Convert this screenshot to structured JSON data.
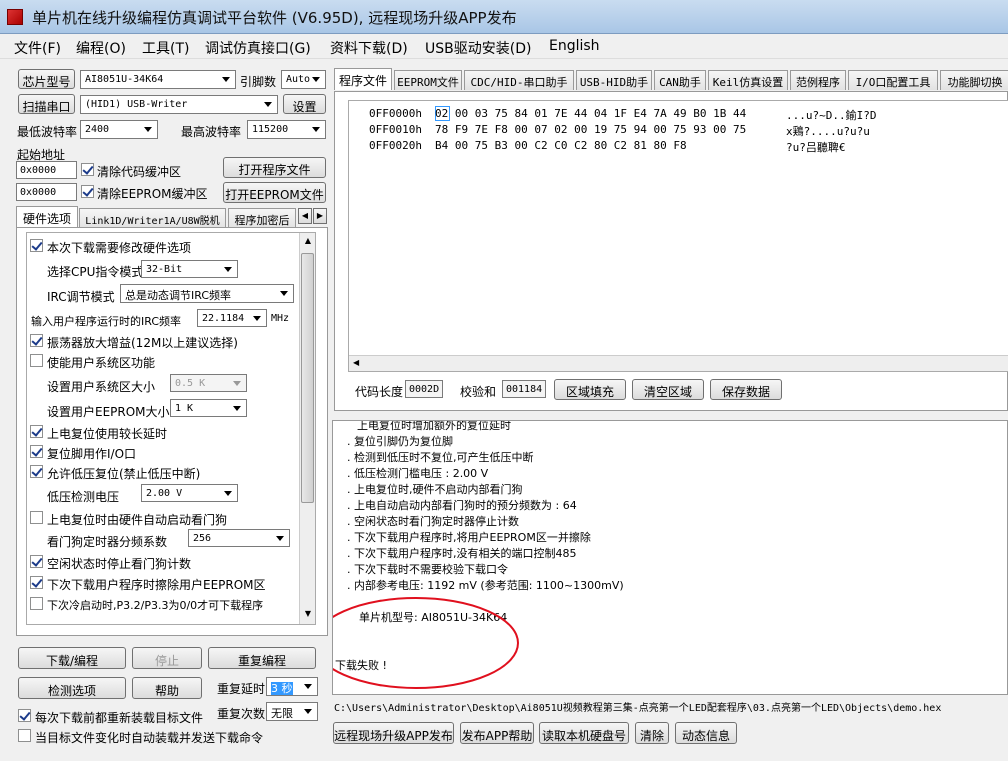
{
  "window": {
    "title": "单片机在线升级编程仿真调试平台软件 (V6.95D), 远程现场升级APP发布"
  },
  "menu": [
    "文件(F)",
    "编程(O)",
    "工具(T)",
    "调试仿真接口(G)",
    "资料下载(D)",
    "USB驱动安装(D)",
    "English"
  ],
  "left": {
    "chip_btn": "芯片型号",
    "chip_value": "AI8051U-34K64",
    "pins_label": "引脚数",
    "pins_value": "Auto",
    "scan_btn": "扫描串口",
    "port_value": "(HID1) USB-Writer",
    "settings_btn": "设置",
    "min_baud_label": "最低波特率",
    "min_baud_value": "2400",
    "max_baud_label": "最高波特率",
    "max_baud_value": "115200",
    "start_addr_label": "起始地址",
    "code_addr": "0x0000",
    "clear_code_label": "清除代码缓冲区",
    "open_prog_btn": "打开程序文件",
    "eeprom_addr": "0x0000",
    "clear_eeprom_label": "清除EEPROM缓冲区",
    "open_eeprom_btn": "打开EEPROM文件",
    "tabs": [
      "硬件选项",
      "Link1D/Writer1A/U8W脱机",
      "程序加密后"
    ],
    "hw": {
      "modify_hw": "本次下载需要修改硬件选项",
      "cpu_label": "选择CPU指令模式",
      "cpu_value": "32-Bit",
      "irc_label": "IRC调节模式",
      "irc_value": "总是动态调节IRC频率",
      "freq_label": "输入用户程序运行时的IRC频率",
      "freq_value": "22.1184",
      "freq_unit": "MHz",
      "osc": "振荡器放大增益(12M以上建议选择)",
      "sys_area": "使能用户系统区功能",
      "sys_size_label": "设置用户系统区大小",
      "sys_size_value": "0.5 K",
      "eeprom_size_label": "设置用户EEPROM大小",
      "eeprom_size_value": "1   K",
      "long_delay": "上电复位使用较长延时",
      "reset_io": "复位脚用作I/O口",
      "lvr": "允许低压复位(禁止低压中断)",
      "lvd_label": "低压检测电压",
      "lvd_value": "2.00 V",
      "wdt_auto": "上电复位时由硬件自动启动看门狗",
      "wdt_div_label": "看门狗定时器分频系数",
      "wdt_div_value": "256",
      "idle_wdt": "空闲状态时停止看门狗计数",
      "erase_eeprom": "下次下载用户程序时擦除用户EEPROM区",
      "p32p33": "下次冷启动时,P3.2/P3.3为0/0才可下载程序"
    },
    "download_btn": "下载/编程",
    "stop_btn": "停止",
    "reprog_btn": "重复编程",
    "detect_btn": "检测选项",
    "help_btn": "帮助",
    "repeat_delay_label": "重复延时",
    "repeat_delay_value": "3 秒",
    "repeat_count_label": "重复次数",
    "repeat_count_value": "无限",
    "reload_label": "每次下载前都重新装载目标文件",
    "autoload_label": "当目标文件变化时自动装载并发送下载命令"
  },
  "right": {
    "tabs": [
      "程序文件",
      "EEPROM文件",
      "CDC/HID-串口助手",
      "USB-HID助手",
      "CAN助手",
      "Keil仿真设置",
      "范例程序",
      "I/O口配置工具",
      "功能脚切换"
    ],
    "hex_rows": [
      {
        "addr": "0FF0000h",
        "bytes": "02 00 03 75 84 01 7E 44 04 1F E4 7A 49 B0 1B 44",
        "ascii": "...u?~D..鍮I?D"
      },
      {
        "addr": "0FF0010h",
        "bytes": "78 F9 7E F8 00 07 02 00 19 75 94 00 75 93 00 75",
        "ascii": "x鶏?....u?u?u"
      },
      {
        "addr": "0FF0020h",
        "bytes": "B4 00 75 B3 00 C2 C0 C2 80 C2 81 80 F8",
        "ascii": "?u?吕聽聛€"
      }
    ],
    "code_len_label": "代码长度",
    "code_len": "0002D",
    "checksum_label": "校验和",
    "checksum": "001184",
    "fill_btn": "区域填充",
    "clear_btn": "清空区域",
    "save_btn": "保存数据",
    "log": [
      "上电复位时增加额外的复位延时",
      ". 复位引脚仍为复位脚",
      ". 检测到低压时不复位,可产生低压中断",
      ". 低压检测门槛电压 : 2.00 V",
      ". 上电复位时,硬件不启动内部看门狗",
      ". 上电自动启动内部看门狗时的预分频数为 : 64",
      ". 空闲状态时看门狗定时器停止计数",
      ". 下次下载用户程序时,将用户EEPROM区一并擦除",
      ". 下次下载用户程序时,没有相关的端口控制485",
      ". 下次下载时不需要校验下载口令",
      ". 内部参考电压: 1192 mV (参考范围: 1100~1300mV)"
    ],
    "mcu_line": "单片机型号: AI8051U-34K64",
    "fail_line": "下载失败 !",
    "path": "C:\\Users\\Administrator\\Desktop\\Ai8051U视频教程第三集-点亮第一个LED配套程序\\03.点亮第一个LED\\Objects\\demo.hex",
    "bottom_btns": [
      "远程现场升级APP发布",
      "发布APP帮助",
      "读取本机硬盘号",
      "清除",
      "动态信息"
    ]
  },
  "colors": {
    "annotation": "#e0101e",
    "selection": "#3399ff"
  }
}
